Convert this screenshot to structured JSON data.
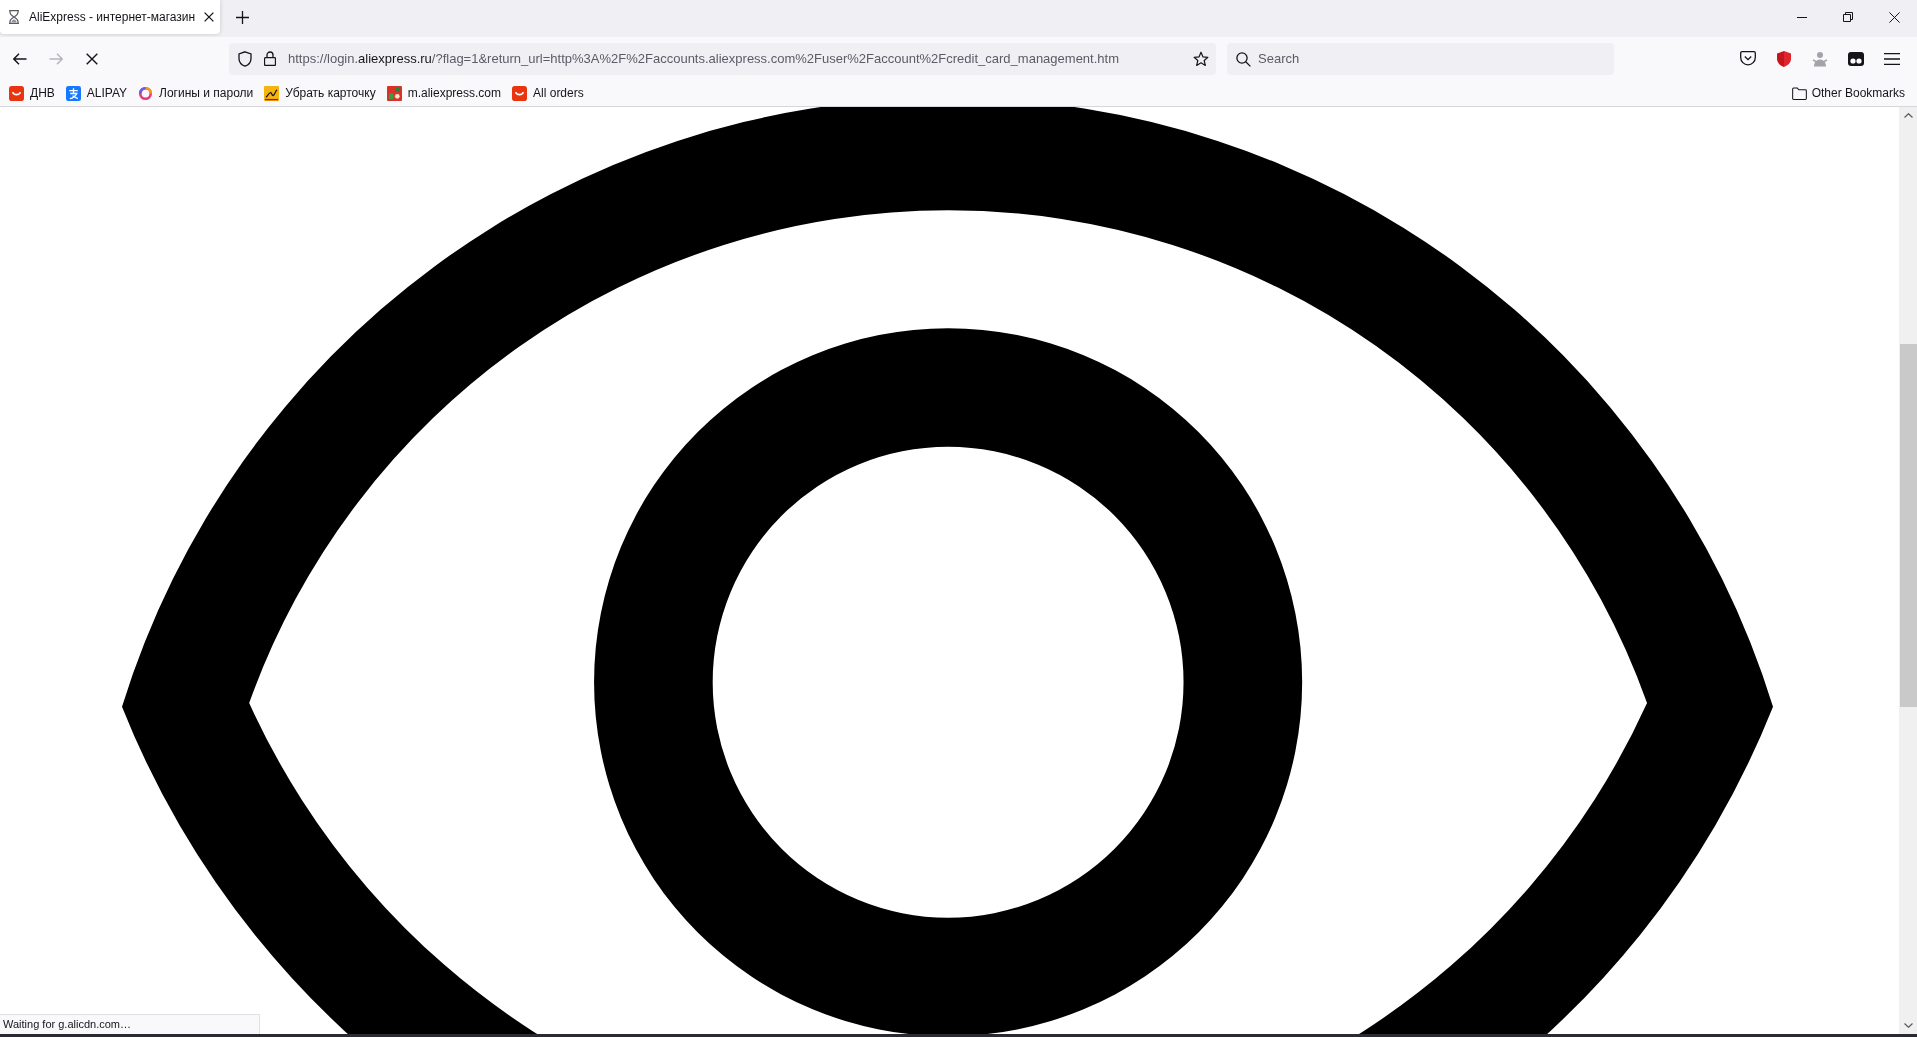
{
  "tabs": [
    {
      "title": "AliExpress - интернет-магазин",
      "loading": true,
      "selected": true
    }
  ],
  "nav_buttons": [
    {
      "kind": "back",
      "disabled": false
    },
    {
      "kind": "forward",
      "disabled": true
    },
    {
      "kind": "stop",
      "disabled": false
    }
  ],
  "address_bar": {
    "url_start": "https://login.",
    "url_domain": "aliexpress.ru",
    "url_rest": "/?flag=1&return_url=http%3A%2F%2Faccounts.aliexpress.com%2Fuser%2Faccount%2Fcredit_card_management.htm",
    "bookmarked": false
  },
  "search": {
    "placeholder": "Search"
  },
  "bookmarks": [
    {
      "label": "ДНВ",
      "kind": "smile"
    },
    {
      "label": "ALIPAY",
      "kind": "alipay"
    },
    {
      "label": "Логины и пароли",
      "kind": "ring"
    },
    {
      "label": "Убрать карточку",
      "kind": "sign"
    },
    {
      "label": "m.aliexpress.com",
      "kind": "collage"
    },
    {
      "label": "All orders",
      "kind": "smile"
    }
  ],
  "other_bookmarks": {
    "label": "Other Bookmarks"
  },
  "status_bar": {
    "text": "Waiting for g.alicdn.com…"
  }
}
